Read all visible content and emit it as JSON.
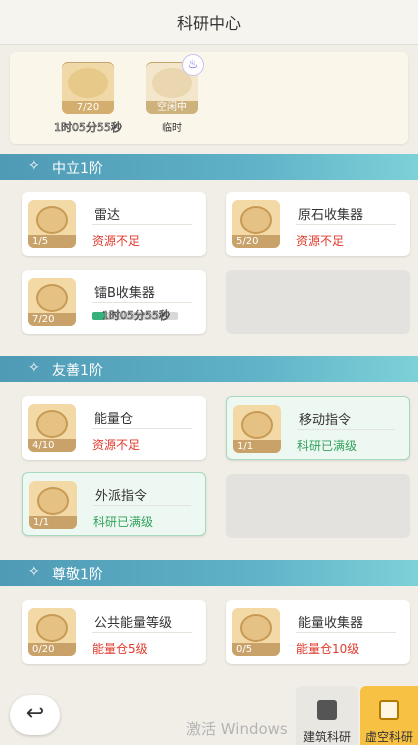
{
  "header": {
    "title": "科研中心"
  },
  "queue": {
    "slot1": {
      "count": "7/20",
      "timer": "1时05分55秒"
    },
    "slot2": {
      "status": "空闲中",
      "sub": "临时",
      "badge_icon": "flame-icon"
    }
  },
  "sections": [
    {
      "title": "中立1阶",
      "cards": [
        {
          "name": "雷达",
          "count": "1/5",
          "status": "资源不足",
          "status_color": "#e0392b"
        },
        {
          "name": "原石收集器",
          "count": "5/20",
          "status": "资源不足",
          "status_color": "#e0392b"
        },
        {
          "name": "镭B收集器",
          "count": "7/20",
          "timer": "1时05分55秒",
          "progress": 0.15
        }
      ]
    },
    {
      "title": "友善1阶",
      "cards": [
        {
          "name": "能量仓",
          "count": "4/10",
          "status": "资源不足",
          "status_color": "#e0392b"
        },
        {
          "name": "移动指令",
          "count": "1/1",
          "status": "科研已满级",
          "status_color": "#31a25b"
        },
        {
          "name": "外派指令",
          "count": "1/1",
          "status": "科研已满级",
          "status_color": "#31a25b"
        }
      ]
    },
    {
      "title": "尊敬1阶",
      "cards": [
        {
          "name": "公共能量等级",
          "count": "0/20",
          "status": "能量仓5级",
          "status_color": "#e0392b"
        },
        {
          "name": "能量收集器",
          "count": "0/5",
          "status": "能量仓10级",
          "status_color": "#e0392b"
        }
      ]
    }
  ],
  "bottom": {
    "watermark": "激活 Windows",
    "tabs": [
      {
        "label": "建筑科研",
        "icon": "book-icon"
      },
      {
        "label": "虚空科研",
        "icon": "cat-mask-icon"
      }
    ]
  }
}
